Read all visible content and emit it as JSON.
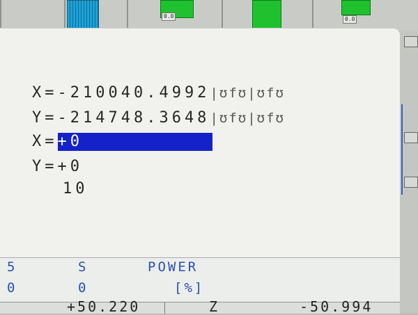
{
  "top_bar": {
    "gauge_left_label": "0.0",
    "gauge_right_label": "0.0"
  },
  "display": {
    "line1": {
      "prefix": "X=-210040.4992",
      "glyphs": "|ʊfʊ|ʊfʊ"
    },
    "line2": {
      "prefix": "Y=-214748.3648",
      "glyphs": "|ʊfʊ|ʊfʊ"
    },
    "line3": {
      "label": "X=",
      "value": "+0"
    },
    "line4": "Y=+0",
    "line5": "10"
  },
  "status": {
    "col1_top": "5",
    "col1_bottom": "0",
    "col2_top": "S",
    "col2_bottom": "0",
    "power_label": "POWER",
    "power_unit": "[%]"
  },
  "bottom_row": {
    "left_value": "+50.220",
    "mid_value": "Z",
    "right_value": "-50.994"
  },
  "colors": {
    "selection": "#1522c9",
    "status_text": "#2a4fb0",
    "screen_bg": "#f1f1ee"
  }
}
